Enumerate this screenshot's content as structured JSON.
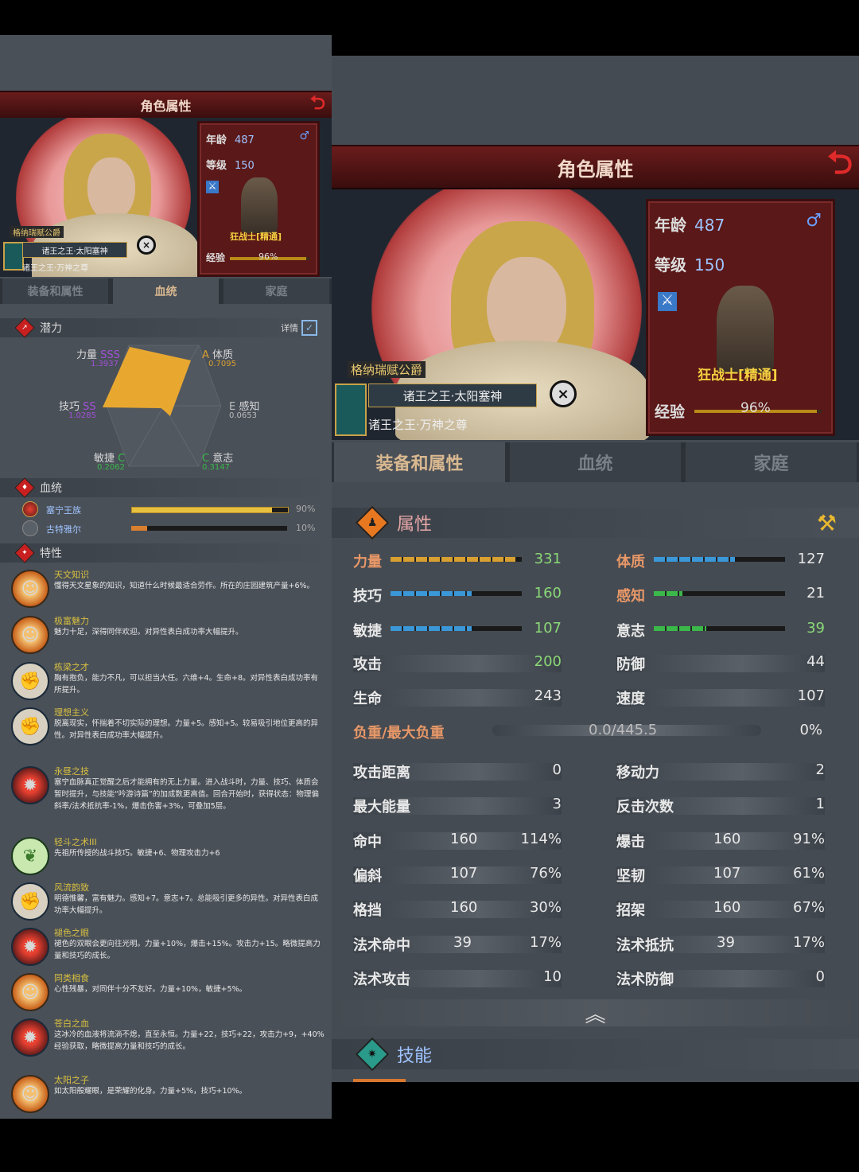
{
  "left_panel": {
    "title": "角色属性",
    "character": {
      "age_label": "年龄",
      "age": "487",
      "level_label": "等级",
      "level": "150",
      "class_name": "狂战士[精通]",
      "exp_label": "经验",
      "exp_percent": "96%",
      "exp_fraction": 0.96,
      "faction_title": "格纳瑞赋公爵",
      "banner_title": "诸王之王·太阳塞神",
      "sub_title": "诸王之王·万神之尊"
    },
    "tabs": [
      "装备和属性",
      "血统",
      "家庭"
    ],
    "active_tab": 1,
    "potential": {
      "header": "潜力",
      "detail_label": "详情",
      "stats": [
        {
          "name": "力量",
          "grade": "SSS",
          "value": "1.3937"
        },
        {
          "name": "体质",
          "grade": "A",
          "value": "0.7095"
        },
        {
          "name": "感知",
          "grade": "E",
          "value": "0.0653"
        },
        {
          "name": "意志",
          "grade": "C",
          "value": "0.3147"
        },
        {
          "name": "敏捷",
          "grade": "C",
          "value": "0.2062"
        },
        {
          "name": "技巧",
          "grade": "SS",
          "value": "1.0285"
        }
      ]
    },
    "bloodline": {
      "header": "血统",
      "items": [
        {
          "name": "塞宁王族",
          "percent": "90%",
          "fraction": 0.9
        },
        {
          "name": "古特雅尔",
          "percent": "10%",
          "fraction": 0.1
        }
      ]
    },
    "traits": {
      "header": "特性",
      "items": [
        {
          "name": "天文知识",
          "icon": "sun-face-icon",
          "desc": "懂得天文星象的知识，知道什么时候最适合劳作。所在的庄园建筑产量+6%。"
        },
        {
          "name": "极富魅力",
          "icon": "sun-face-icon",
          "desc": "魅力十足，深得同伴欢迎。对异性表白成功率大幅提升。"
        },
        {
          "name": "栋梁之才",
          "icon": "arm-icon",
          "desc": "胸有抱负，能力不凡，可以担当大任。六维+4。生命+8。对异性表白成功率有所提升。"
        },
        {
          "name": "理想主义",
          "icon": "arm-icon",
          "desc": "脱离现实，怀揣着不切实际的理想。力量+5。感知+5。较易吸引地位更高的异性。对异性表白成功率大幅提升。"
        },
        {
          "name": "永昼之技",
          "icon": "red-burst-icon",
          "desc": "塞宁血脉真正觉醒之后才能拥有的无上力量。进入战斗时，力量、技巧、体质会暂时提升，与技能“吟游诗篇”的加成数更高值。回合开始时，获得状态：物理偏斜率/法术抵抗率-1%，爆击伤害+3%，可叠加5层。"
        },
        {
          "name": "轻斗之术III",
          "icon": "leaf-icon",
          "desc": "先祖所传授的战斗技巧。敏捷+6、物理攻击力+6"
        },
        {
          "name": "风流韵致",
          "icon": "arm-icon",
          "desc": "明德惟馨，富有魅力。感知+7。意志+7。总能吸引更多的异性。对异性表白成功率大幅提升。"
        },
        {
          "name": "褪色之眼",
          "icon": "red-burst-icon",
          "desc": "褪色的双眼会更向往光明。力量+10%，爆击+15%。攻击力+15。略微提高力量和技巧的成长。"
        },
        {
          "name": "同类相食",
          "icon": "sun-face-icon",
          "desc": "心性残暴，对同伴十分不友好。力量+10%，敏捷+5%。"
        },
        {
          "name": "苍白之血",
          "icon": "red-burst-icon",
          "desc": "这冰冷的血液将流淌不熄，直至永恒。力量+22，技巧+22，攻击力+9，+40%经验获取，略微提高力量和技巧的成长。"
        },
        {
          "name": "太阳之子",
          "icon": "sun-face-icon",
          "desc": "如太阳般耀眼，是荣耀的化身。力量+5%，技巧+10%。"
        }
      ]
    }
  },
  "right_panel": {
    "title": "角色属性",
    "character": {
      "age_label": "年龄",
      "age": "487",
      "level_label": "等级",
      "level": "150",
      "class_name": "狂战士[精通]",
      "exp_label": "经验",
      "exp_percent": "96%",
      "exp_fraction": 0.96,
      "faction_title": "格纳瑞赋公爵",
      "banner_title": "诸王之王·太阳塞神",
      "sub_title": "诸王之王·万神之尊"
    },
    "tabs": [
      "装备和属性",
      "血统",
      "家庭"
    ],
    "active_tab": 0,
    "attributes_header": "属性",
    "primary_stats": [
      {
        "name": "力量",
        "value": "331",
        "color": "#d8a030",
        "fraction": 0.95
      },
      {
        "name": "体质",
        "value": "127",
        "color": "#3a98d8",
        "fraction": 0.62
      },
      {
        "name": "技巧",
        "value": "160",
        "color": "#3a98d8",
        "fraction": 0.62
      },
      {
        "name": "感知",
        "value": "21",
        "color": "#3ab84a",
        "fraction": 0.22
      },
      {
        "name": "敏捷",
        "value": "107",
        "color": "#3a98d8",
        "fraction": 0.62
      },
      {
        "name": "意志",
        "value": "39",
        "color": "#3ab84a",
        "fraction": 0.4
      }
    ],
    "attack_label": "攻击",
    "attack_value": "200",
    "defense_label": "防御",
    "defense_value": "44",
    "hp_label": "生命",
    "hp_value": "243",
    "speed_label": "速度",
    "speed_value": "107",
    "load_label": "负重/最大负重",
    "load_value": "0.0/445.5",
    "load_percent": "0%",
    "range_label": "攻击距离",
    "range_value": "0",
    "move_label": "移动力",
    "move_value": "2",
    "energy_label": "最大能量",
    "energy_value": "3",
    "counter_label": "反击次数",
    "counter_value": "1",
    "combat_stats": [
      {
        "name": "命中",
        "value": "160",
        "pct": "114%"
      },
      {
        "name": "爆击",
        "value": "160",
        "pct": "91%"
      },
      {
        "name": "偏斜",
        "value": "107",
        "pct": "76%"
      },
      {
        "name": "坚韧",
        "value": "107",
        "pct": "61%"
      },
      {
        "name": "格挡",
        "value": "160",
        "pct": "30%"
      },
      {
        "name": "招架",
        "value": "160",
        "pct": "67%"
      },
      {
        "name": "法术命中",
        "value": "39",
        "pct": "17%"
      },
      {
        "name": "法术抵抗",
        "value": "39",
        "pct": "17%"
      }
    ],
    "magic_attack_label": "法术攻击",
    "magic_attack_value": "10",
    "magic_defense_label": "法术防御",
    "magic_defense_value": "0",
    "skills_header": "技能"
  }
}
